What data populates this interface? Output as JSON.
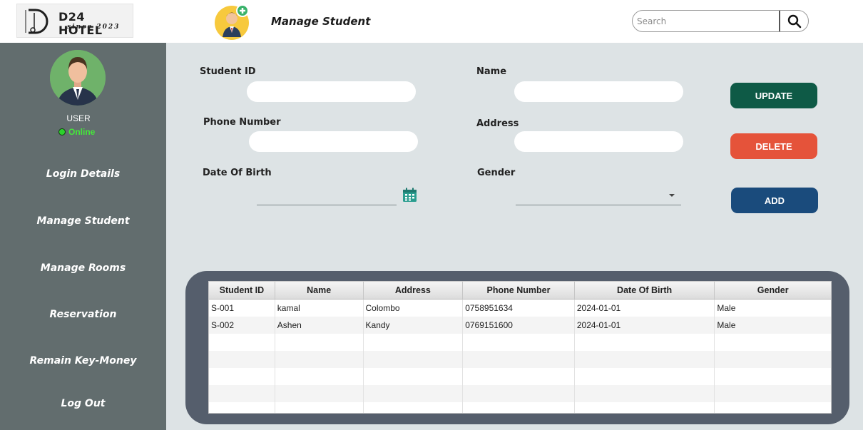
{
  "header": {
    "logo_text": "D24 HOTEL",
    "logo_sub": "since 2023",
    "logo_mark": "D",
    "page_title": "Manage Student",
    "page_icon": "add-student-icon",
    "search_placeholder": "Search",
    "search_icon": "search-icon"
  },
  "sidebar": {
    "user_label": "USER",
    "status_text": "Online",
    "status_color": "#2cd12c",
    "items": [
      {
        "label": "Login Details"
      },
      {
        "label": "Manage Student"
      },
      {
        "label": "Manage Rooms"
      },
      {
        "label": "Reservation"
      },
      {
        "label": "Remain Key-Money"
      },
      {
        "label": "Log Out"
      }
    ]
  },
  "form": {
    "student_id_label": "Student ID",
    "name_label": "Name",
    "phone_label": "Phone Number",
    "address_label": "Address",
    "dob_label": "Date Of Birth",
    "gender_label": "Gender",
    "student_id_value": "",
    "name_value": "",
    "phone_value": "",
    "address_value": "",
    "dob_value": "",
    "gender_value": ""
  },
  "buttons": {
    "update": "UPDATE",
    "delete": "DELETE",
    "add": "ADD",
    "update_color": "#0e5a46",
    "delete_color": "#e5533a",
    "add_color": "#1a4b7c"
  },
  "table": {
    "columns": [
      "Student ID",
      "Name",
      "Address",
      "Phone Number",
      "Date Of Birth",
      "Gender"
    ],
    "rows": [
      [
        "S-001",
        "kamal",
        "Colombo",
        "0758951634",
        "2024-01-01",
        "Male"
      ],
      [
        "S-002",
        "Ashen",
        "Kandy",
        "0769151600",
        "2024-01-01",
        "Male"
      ]
    ]
  },
  "colors": {
    "sidebar_bg": "#626d6e",
    "main_bg": "#dde3e5",
    "table_panel_bg": "#555e6c"
  }
}
